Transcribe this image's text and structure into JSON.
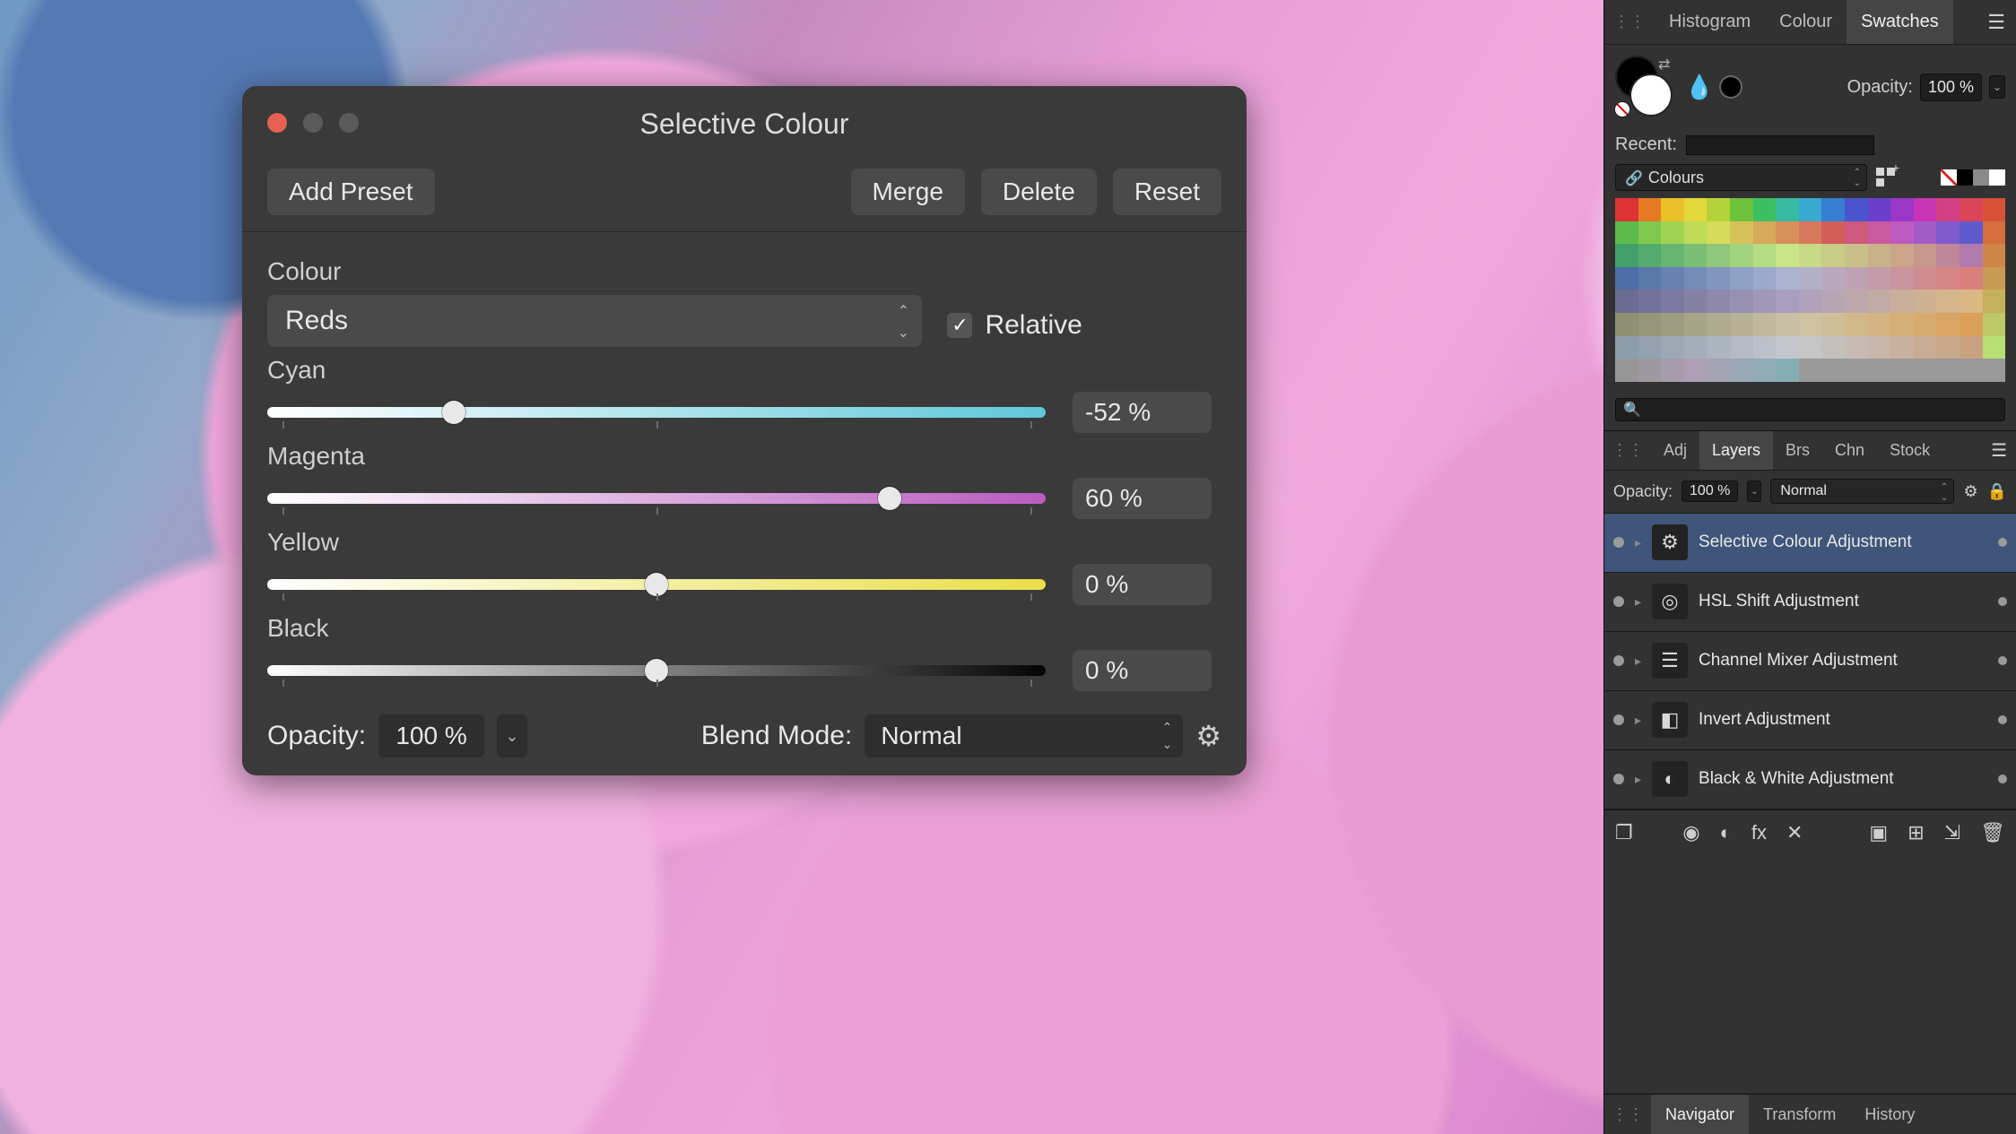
{
  "dialog": {
    "title": "Selective Colour",
    "buttons": {
      "addPreset": "Add Preset",
      "merge": "Merge",
      "delete": "Delete",
      "reset": "Reset"
    },
    "colourLabel": "Colour",
    "colourValue": "Reds",
    "relativeLabel": "Relative",
    "relativeChecked": true,
    "sliders": {
      "cyan": {
        "label": "Cyan",
        "value": "-52 %",
        "pos": 24
      },
      "magenta": {
        "label": "Magenta",
        "value": "60 %",
        "pos": 80
      },
      "yellow": {
        "label": "Yellow",
        "value": "0 %",
        "pos": 50
      },
      "black": {
        "label": "Black",
        "value": "0 %",
        "pos": 50
      }
    },
    "opacityLabel": "Opacity:",
    "opacityValue": "100 %",
    "blendLabel": "Blend Mode:",
    "blendValue": "Normal"
  },
  "swatchTabs": {
    "histogram": "Histogram",
    "colour": "Colour",
    "swatches": "Swatches"
  },
  "swatches": {
    "opacityLabel": "Opacity:",
    "opacityValue": "100 %",
    "recentLabel": "Recent:",
    "sourceLabel": "Colours",
    "gridColors": [
      "#d33",
      "#e67a24",
      "#eac028",
      "#e3d93d",
      "#b4d338",
      "#6ec23c",
      "#3cbf61",
      "#36bba0",
      "#3aa9cf",
      "#357ed2",
      "#4a54cf",
      "#6b3ecc",
      "#9a36c8",
      "#c834b5",
      "#d33f84",
      "#d94459",
      "#d85238",
      "#5cbb4a",
      "#7ec94d",
      "#a0d352",
      "#c0db58",
      "#d7db5b",
      "#d7c25a",
      "#d7a95a",
      "#d7905a",
      "#d7785a",
      "#d25e5a",
      "#ce5a7d",
      "#c95aa0",
      "#bf5ac0",
      "#a25ac7",
      "#7f5acc",
      "#5e5acc",
      "#d66e3d",
      "#42a06a",
      "#55aa6e",
      "#68b472",
      "#7bbe76",
      "#8ec87a",
      "#a1d27e",
      "#b4dc82",
      "#c7e686",
      "#c8d987",
      "#c8cc88",
      "#c9bf88",
      "#c9b289",
      "#caa58a",
      "#c5988b",
      "#bf8599",
      "#b37bad",
      "#cf8548",
      "#4d6ea6",
      "#5a78ac",
      "#6782b2",
      "#748cb8",
      "#8196be",
      "#8ea0c4",
      "#9baaCA",
      "#a8b4d0",
      "#b2b0c9",
      "#b8a9be",
      "#bea2b3",
      "#c49ba8",
      "#ca949d",
      "#cf8d92",
      "#d48687",
      "#d97f7c",
      "#c99b52",
      "#6a6c90",
      "#737397",
      "#7c7a9e",
      "#8581a5",
      "#8e88ac",
      "#9790b2",
      "#a097b9",
      "#a99ec0",
      "#b0a2bb",
      "#b6a5b3",
      "#bca8ab",
      "#c2aba3",
      "#c8ae9b",
      "#ceb193",
      "#d4b48b",
      "#dab783",
      "#c3b15d",
      "#8f8f73",
      "#97967a",
      "#9f9d81",
      "#a7a488",
      "#afab8f",
      "#b7b296",
      "#bfb99d",
      "#c7c0a4",
      "#cdc3a1",
      "#cfbe97",
      "#d1b98c",
      "#d3b482",
      "#d5af78",
      "#d7aa6e",
      "#d9a564",
      "#dba05a",
      "#bdc868",
      "#8c9caa",
      "#94a2af",
      "#9ca8b4",
      "#a4aeb9",
      "#acb4be",
      "#b4bac3",
      "#bcc0c8",
      "#c4c6cd",
      "#c6c5c7",
      "#c6c0bd",
      "#c7bbb3",
      "#c7b6a9",
      "#c8b19f",
      "#c8ac95",
      "#c9a78b",
      "#c9a281",
      "#b7df73",
      "#969696",
      "#9e99a0",
      "#a69caa",
      "#ae9fb4",
      "#a4a3b4",
      "#9aa7b4",
      "#90abb4",
      "#86afb4",
      "#999999",
      "#999999",
      "#999999",
      "#999999",
      "#999999",
      "#999999",
      "#999999",
      "#999999",
      "#999999"
    ]
  },
  "layerTabs": {
    "adj": "Adj",
    "layers": "Layers",
    "brs": "Brs",
    "chn": "Chn",
    "stock": "Stock"
  },
  "layerCtrl": {
    "opacityLabel": "Opacity:",
    "opacityValue": "100 %",
    "blendValue": "Normal"
  },
  "layers": [
    {
      "name": "Selective Colour Adjustment",
      "active": true
    },
    {
      "name": "HSL Shift Adjustment",
      "active": false
    },
    {
      "name": "Channel Mixer Adjustment",
      "active": false
    },
    {
      "name": "Invert Adjustment",
      "active": false
    },
    {
      "name": "Black & White Adjustment",
      "active": false
    }
  ],
  "navTabs": {
    "navigator": "Navigator",
    "transform": "Transform",
    "history": "History"
  }
}
